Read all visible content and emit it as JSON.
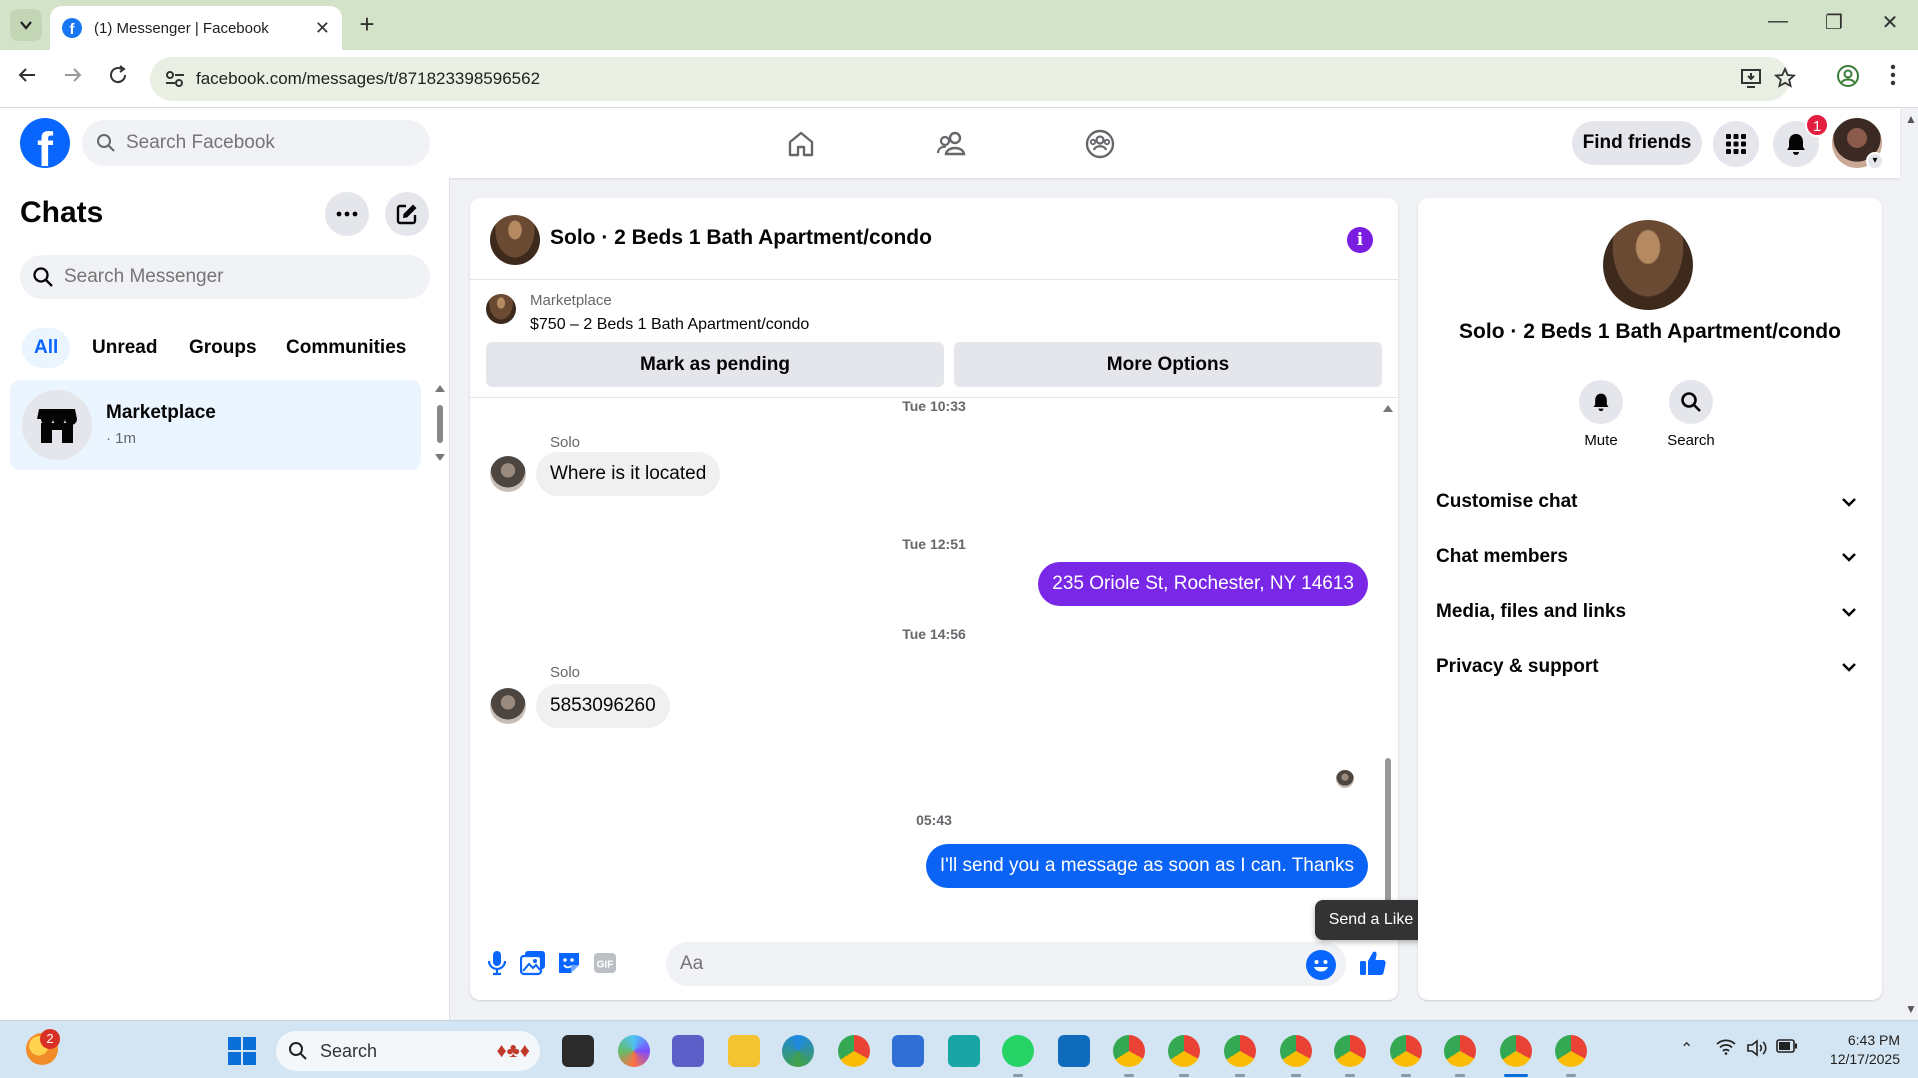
{
  "browser": {
    "tab_title": "(1) Messenger | Facebook",
    "url": "facebook.com/messages/t/871823398596562",
    "new_tab": "+",
    "tab_close": "✕",
    "minimize": "—",
    "restore": "❐",
    "close": "✕"
  },
  "fb_header": {
    "search_placeholder": "Search Facebook",
    "find_friends_label": "Find friends",
    "notification_count": "1"
  },
  "left_panel": {
    "title": "Chats",
    "search_placeholder": "Search Messenger",
    "filters": [
      "All",
      "Unread",
      "Groups",
      "Communities"
    ],
    "chats": [
      {
        "name": "Marketplace",
        "time": "· 1m"
      }
    ]
  },
  "conversation": {
    "title": "Solo · 2 Beds 1 Bath Apartment/condo",
    "marketplace_label": "Marketplace",
    "listing": "$750 – 2 Beds 1 Bath Apartment/condo",
    "mark_pending_label": "Mark as pending",
    "more_options_label": "More Options",
    "messages": {
      "ts1": "Tue 10:33",
      "sender1": "Solo",
      "msg1": "Where is it located",
      "ts2": "Tue 12:51",
      "msg2": "235 Oriole St, Rochester, NY 14613",
      "ts3": "Tue 14:56",
      "sender3": "Solo",
      "msg3": "5853096260",
      "ts4": "05:43",
      "msg4": "I'll send you a message as soon as I can. Thanks"
    },
    "composer_placeholder": "Aa",
    "tooltip": "Send a Like"
  },
  "right_panel": {
    "title": "Solo · 2 Beds 1 Bath Apartment/condo",
    "mute_label": "Mute",
    "search_label": "Search",
    "sections": [
      "Customise chat",
      "Chat members",
      "Media, files and links",
      "Privacy & support"
    ]
  },
  "taskbar": {
    "weather_badge": "2",
    "search_label": "Search",
    "time": "6:43 PM",
    "date": "12/17/2025"
  },
  "colors": {
    "fb_blue": "#0866ff",
    "outgoing_purple": "#7a28e8",
    "outgoing_blue": "#0b63f6",
    "info_purple": "#7a1de0"
  }
}
